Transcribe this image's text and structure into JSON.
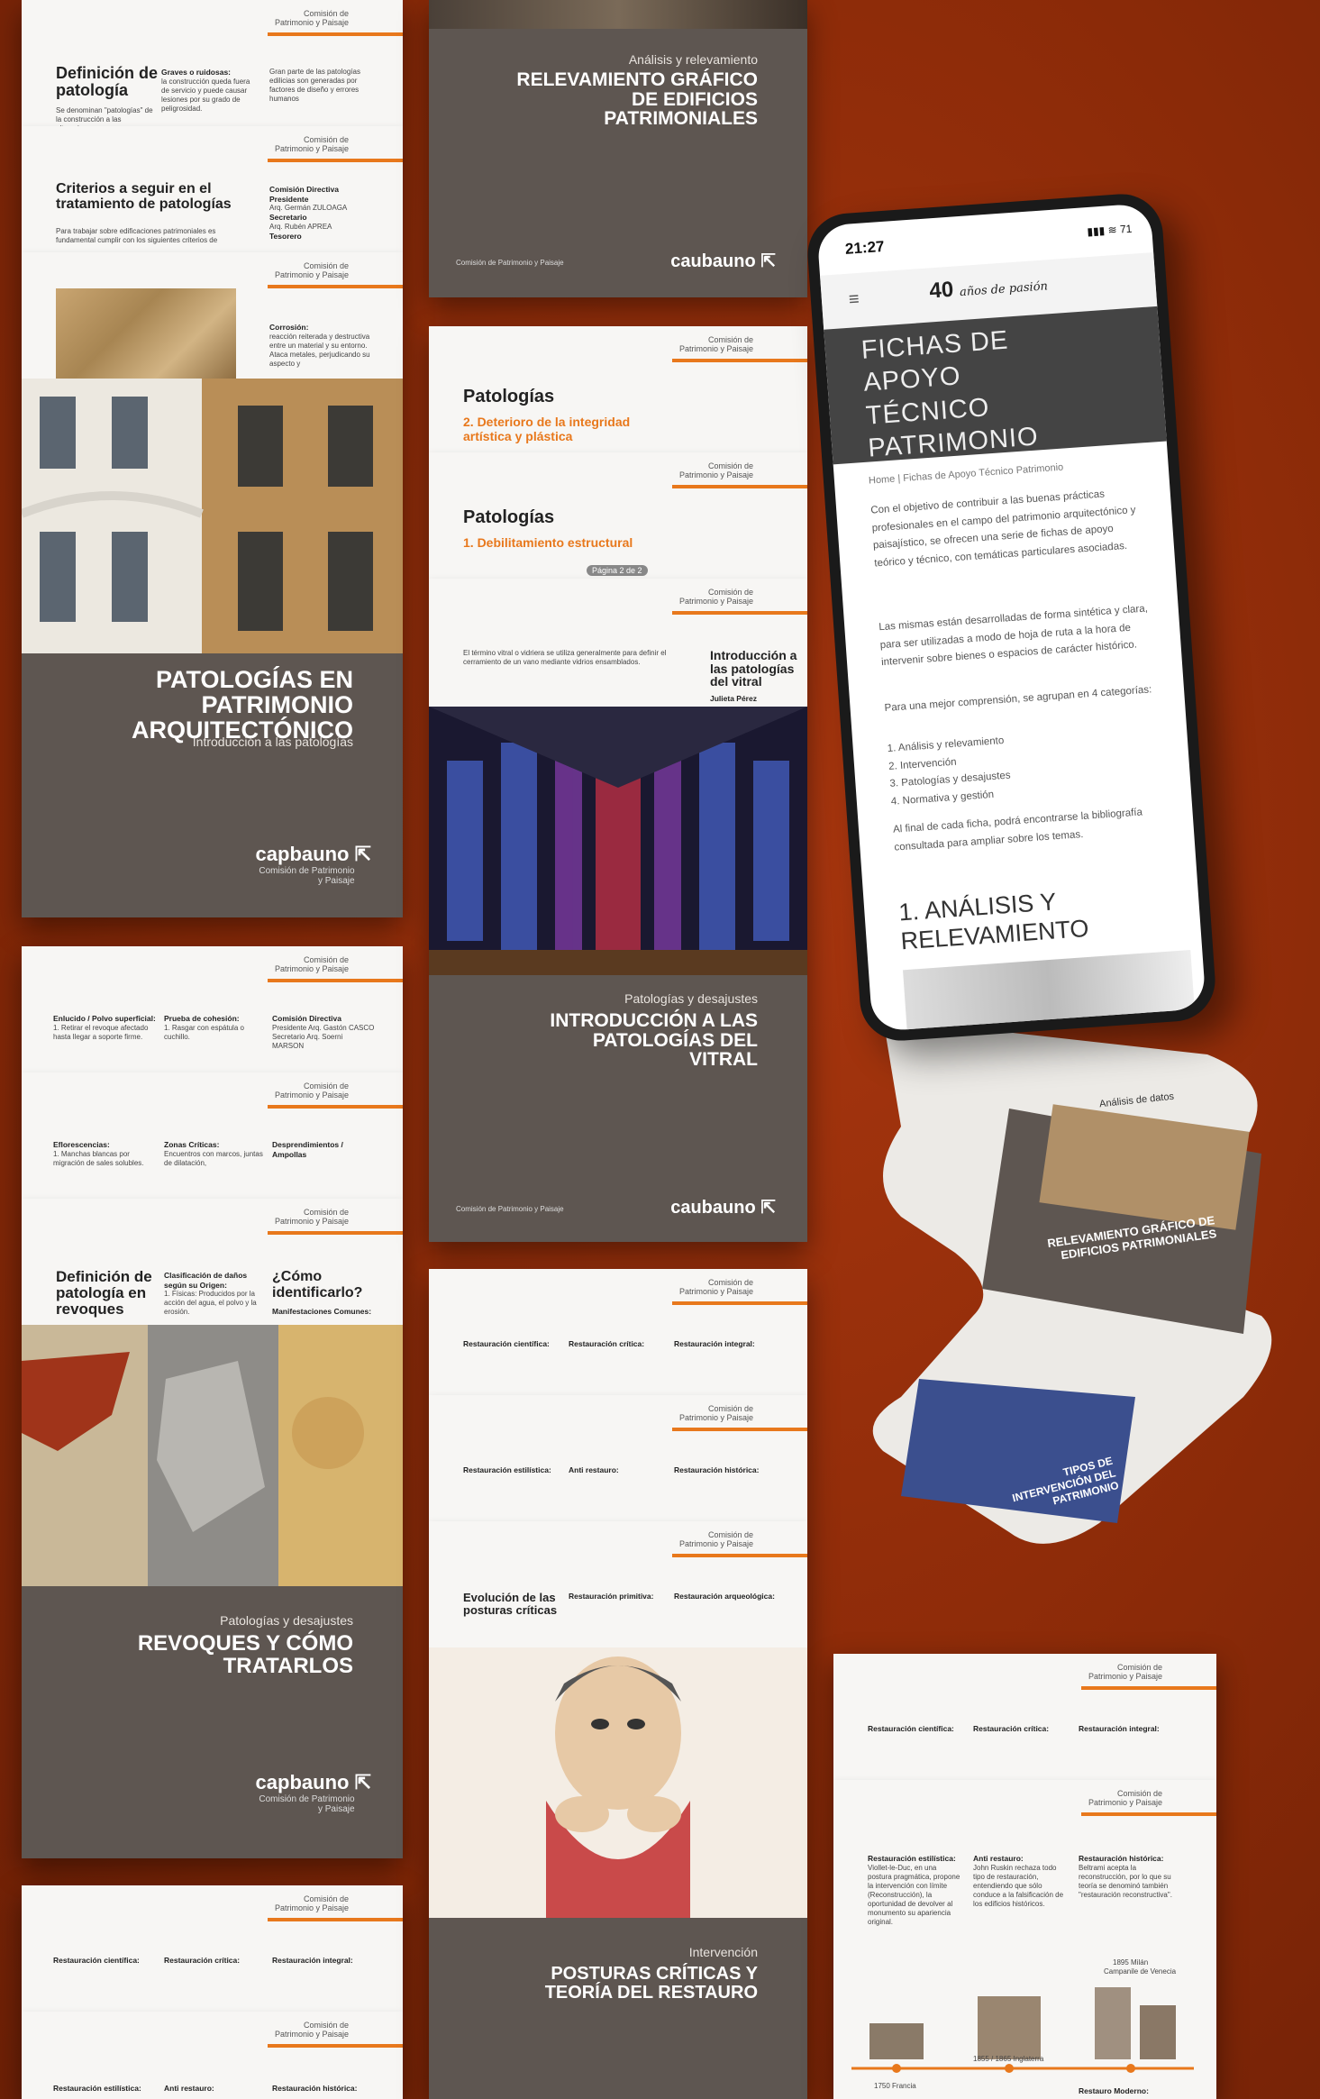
{
  "org": "Comisión de Patrimonio y Paisaje",
  "left_column": {
    "sheet1": {
      "title": "Definición de patología",
      "col1_head": "Graves o ruidosas:",
      "col1_text": "la construcción queda fuera de servicio y puede causar lesiones por su grado de peligrosidad.",
      "col2_text": "Gran parte de las patologías edilicias son generadas por factores de diseño y errores humanos",
      "body": "Se denominan \"patologías\" de la construcción a las alteraciones,"
    },
    "sheet2": {
      "title": "Criterios a seguir en el tratamiento de patologías",
      "col_head": "Comisión Directiva",
      "presidente_label": "Presidente",
      "presidente": "Arq. Germán ZULOAGA",
      "secretario_label": "Secretario",
      "secretario": "Arq. Rubén APREA",
      "tesorero": "Tesorero",
      "body": "Para trabajar sobre edificaciones patrimoniales es fundamental cumplir con los siguientes criterios de"
    },
    "sheet3": {
      "col_head": "Corrosión:",
      "col_text": "reacción reiterada y destructiva entre un material y su entorno. Ataca metales, perjudicando su aspecto y"
    },
    "cover1": {
      "title": "PATOLOGÍAS EN PATRIMONIO ARQUITECTÓNICO",
      "subtitle": "Introducción a las patologías",
      "brand": "capbauno",
      "brand_sub": "Comisión de Patrimonio y Paisaje"
    },
    "sheet4": {
      "c1": "Enlucido / Polvo superficial:",
      "c2": "Prueba de cohesión:",
      "c3": "Comisión Directiva",
      "t1": "1. Retirar el revoque afectado hasta llegar a soporte firme.",
      "t2": "1. Rasgar con espátula o cuchillo.",
      "t3": "Presidente Arq. Gastón CASCO Secretario Arq. Soerni MARSON"
    },
    "sheet5": {
      "c1": "Eflorescencias:",
      "c2": "Zonas Críticas:",
      "t1": "1. Manchas blancas por migración de sales solubles.",
      "t2": "Encuentros con marcos, juntas de dilatación,",
      "t3": "Desprendimientos / Ampollas"
    },
    "sheet6": {
      "title": "Definición de patología en revoques",
      "c2": "Clasificación de daños según su Origen:",
      "c3_title": "¿Cómo identificarlo?",
      "c3_head": "Manifestaciones Comunes:",
      "t2": "1. Físicas: Producidos por la acción del agua, el polvo y la erosión."
    },
    "cover2": {
      "category": "Patologías y desajustes",
      "title": "REVOQUES Y CÓMO TRATARLOS",
      "brand": "capbauno",
      "brand_sub": "Comisión de Patrimonio y Paisaje"
    },
    "sheet7": {
      "c1": "Restauración científica:",
      "c2": "Restauración crítica:",
      "c3": "Restauración integral:"
    },
    "sheet8": {
      "c1": "Restauración estilística:",
      "c2": "Anti restauro:",
      "c3": "Restauración histórica:"
    }
  },
  "middle_column": {
    "cover1": {
      "category": "Análisis y relevamiento",
      "title": "RELEVAMIENTO GRÁFICO DE EDIFICIOS PATRIMONIALES",
      "footer": "Comisión de Patrimonio y Paisaje",
      "brand": "caubauno"
    },
    "sheet1": {
      "title": "Patologías",
      "subtitle": "2. Deterioro de la integridad artística y plástica"
    },
    "sheet2": {
      "title": "Patologías",
      "subtitle": "1. Debilitamiento estructural",
      "page": "Página 2 de 2"
    },
    "sheet3": {
      "title": "Introducción a las patologías del vitral",
      "author": "Julieta Pérez",
      "body": "El término vitral o vidriera se utiliza generalmente para definir el cerramiento de un vano mediante vidrios ensamblados."
    },
    "cover2": {
      "category": "Patologías y desajustes",
      "title": "INTRODUCCIÓN A LAS PATOLOGÍAS DEL VITRAL",
      "footer": "Comisión de Patrimonio y Paisaje",
      "brand": "caubauno"
    },
    "sheet4": {
      "c1": "Restauración científica:",
      "c2": "Restauración crítica:",
      "c3": "Restauración integral:"
    },
    "sheet5": {
      "c1": "Restauración estilística:",
      "c2": "Anti restauro:",
      "c3": "Restauración histórica:"
    },
    "sheet6": {
      "title": "Evolución de las posturas críticas",
      "c2": "Restauración primitiva:",
      "c3": "Restauración arqueológica:"
    },
    "cover3": {
      "category": "Intervención",
      "title": "POSTURAS CRÍTICAS Y TEORÍA DEL RESTAURO"
    }
  },
  "phone": {
    "time": "21:27",
    "status_right": "▮▮▮ ≋ 71",
    "logo_number": "40",
    "logo_text": "años de pasión",
    "title": "FICHAS DE APOYO TÉCNICO PATRIMONIO",
    "breadcrumb": "Home | Fichas de Apoyo Técnico Patrimonio",
    "p1": "Con el objetivo de contribuir a las buenas prácticas profesionales en el campo del patrimonio arquitectónico y paisajístico, se ofrecen una serie de fichas de apoyo teórico y técnico, con temáticas particulares asociadas.",
    "p2": "Las mismas están desarrolladas de forma sintética y clara, para ser utilizadas a modo de hoja de ruta a la hora de intervenir sobre bienes o espacios de carácter histórico.",
    "p3": "Para una mejor comprensión, se agrupan en 4 categorías:",
    "list": [
      "1. Análisis y relevamiento",
      "2. Intervención",
      "3. Patologías y desajustes",
      "4. Normativa y gestión"
    ],
    "p4": "Al final de cada ficha, podrá encontrarse la bibliografía consultada para ampliar sobre los temas.",
    "section": "1. ANÁLISIS Y RELEVAMIENTO",
    "scroll_cover1": "RELEVAMIENTO GRÁFICO DE EDIFICIOS PATRIMONIALES",
    "scroll_cat": "Análisis de datos",
    "scroll_cover2": "TIPOS DE INTERVENCIÓN DEL PATRIMONIO"
  },
  "right_bottom": {
    "sheet1": {
      "c1": "Restauración científica:",
      "c2": "Restauración crítica:",
      "c3": "Restauración integral:"
    },
    "sheet2": {
      "c1": "Restauración estilística:",
      "c2": "Anti restauro:",
      "c3": "Restauración histórica:",
      "t1": "Viollet-le-Duc, en una postura pragmática, propone la intervención con límite (Reconstrucción), la oportunidad de devolver al monumento su apariencia original.",
      "t2": "John Ruskin rechaza todo tipo de restauración, entendiendo que sólo conduce a la falsificación de los edificios históricos.",
      "t3": "Beltrami acepta la reconstrucción, por lo que su teoría se denominó también \"restauración reconstructiva\".",
      "cap1": "1750 Francia",
      "cap2": "1855 / 1865 Inglaterra",
      "cap3": "1895 Milán",
      "cap3b": "Campanile de Venecia",
      "c4": "Restauro Moderno:"
    }
  }
}
